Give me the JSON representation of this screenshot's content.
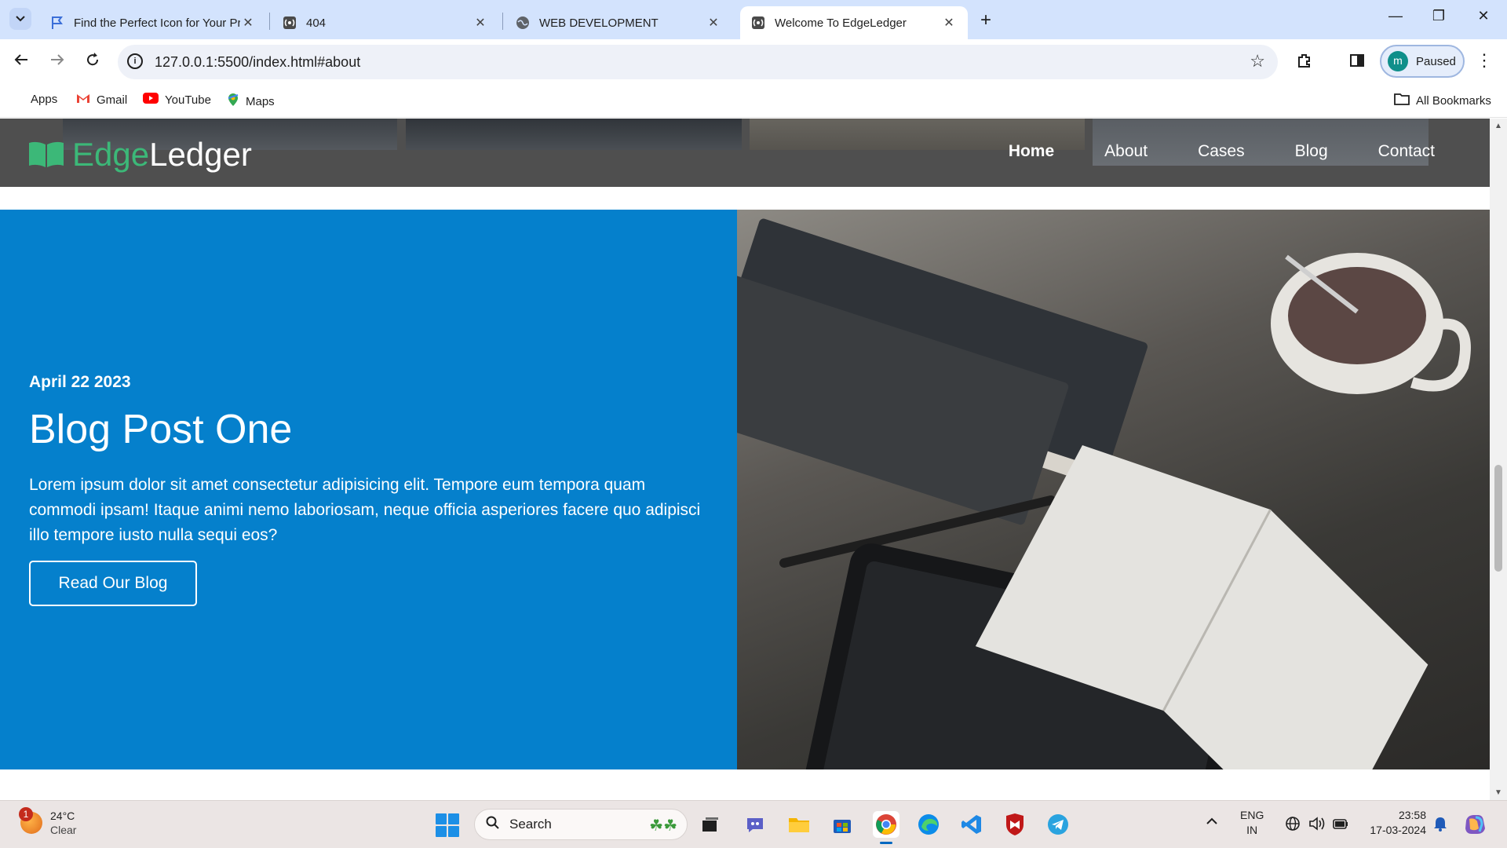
{
  "browser": {
    "tabs": [
      {
        "title": "Find the Perfect Icon for Your Pr",
        "active": false
      },
      {
        "title": "404",
        "active": false
      },
      {
        "title": "WEB DEVELOPMENT",
        "active": false
      },
      {
        "title": "Welcome To EdgeLedger",
        "active": true
      }
    ],
    "url": "127.0.0.1:5500/index.html#about",
    "profile_initial": "m",
    "profile_status": "Paused",
    "bookmarks": [
      "Apps",
      "Gmail",
      "YouTube",
      "Maps"
    ],
    "all_bookmarks": "All Bookmarks"
  },
  "site": {
    "logo_part1": "Edge",
    "logo_part2": "Ledger",
    "nav": [
      "Home",
      "About",
      "Cases",
      "Blog",
      "Contact"
    ],
    "active_nav": "Home",
    "accent": "#3cb878",
    "blog": {
      "date": "April 22 2023",
      "title": "Blog Post One",
      "text": "Lorem ipsum dolor sit amet consectetur adipisicing elit. Tempore eum tempora quam commodi ipsam! Itaque animi nemo laboriosam, neque officia asperiores facere quo adipisci illo tempore iusto nulla sequi eos?",
      "button": "Read Our Blog",
      "bg_color": "#0580cc"
    }
  },
  "taskbar": {
    "weather_temp": "24°C",
    "weather_cond": "Clear",
    "weather_badge": "1",
    "search_placeholder": "Search",
    "lang_top": "ENG",
    "lang_bottom": "IN",
    "time": "23:58",
    "date": "17-03-2024"
  }
}
